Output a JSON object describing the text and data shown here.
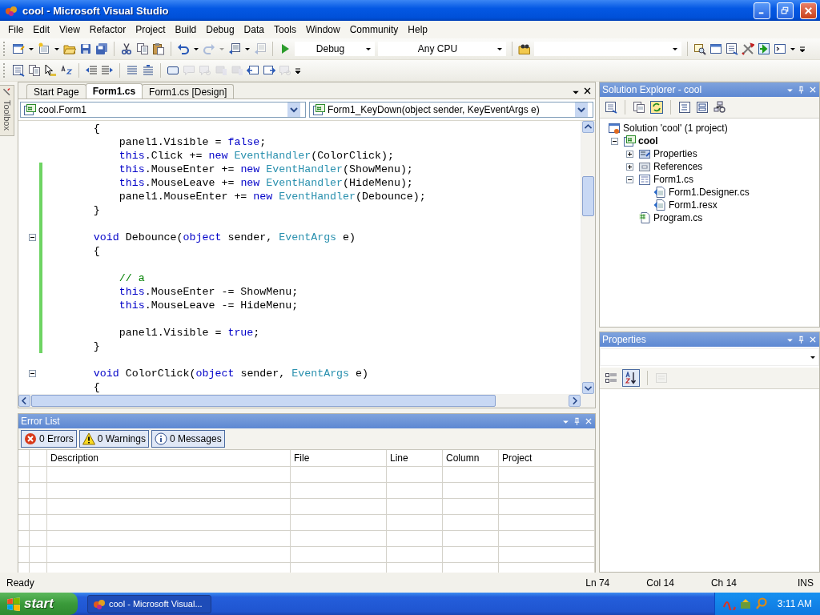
{
  "window": {
    "title": "cool - Microsoft Visual Studio"
  },
  "menu": [
    "File",
    "Edit",
    "View",
    "Refactor",
    "Project",
    "Build",
    "Debug",
    "Data",
    "Tools",
    "Window",
    "Community",
    "Help"
  ],
  "toolbar": {
    "configuration": "Debug",
    "platform": "Any CPU"
  },
  "toolbox": {
    "label": "Toolbox"
  },
  "editor": {
    "tabs": [
      {
        "label": "Start Page",
        "selected": false
      },
      {
        "label": "Form1.cs",
        "selected": true
      },
      {
        "label": "Form1.cs [Design]",
        "selected": false
      }
    ],
    "type_dropdown": "cool.Form1",
    "member_dropdown": "Form1_KeyDown(object sender, KeyEventArgs e)",
    "lines": [
      {
        "modified": false,
        "tokens": [
          {
            "kind": "plain",
            "text": "        {"
          }
        ]
      },
      {
        "modified": false,
        "tokens": [
          {
            "kind": "plain",
            "text": "            panel1.Visible = "
          },
          {
            "kind": "keyword",
            "text": "false"
          },
          {
            "kind": "plain",
            "text": ";"
          }
        ]
      },
      {
        "modified": false,
        "tokens": [
          {
            "kind": "keyword",
            "text": "            this"
          },
          {
            "kind": "plain",
            "text": ".Click += "
          },
          {
            "kind": "keyword",
            "text": "new "
          },
          {
            "kind": "type",
            "text": "EventHandler"
          },
          {
            "kind": "plain",
            "text": "(ColorClick);"
          }
        ]
      },
      {
        "modified": true,
        "tokens": [
          {
            "kind": "keyword",
            "text": "            this"
          },
          {
            "kind": "plain",
            "text": ".MouseEnter += "
          },
          {
            "kind": "keyword",
            "text": "new "
          },
          {
            "kind": "type",
            "text": "EventHandler"
          },
          {
            "kind": "plain",
            "text": "(ShowMenu);"
          }
        ]
      },
      {
        "modified": true,
        "tokens": [
          {
            "kind": "keyword",
            "text": "            this"
          },
          {
            "kind": "plain",
            "text": ".MouseLeave += "
          },
          {
            "kind": "keyword",
            "text": "new "
          },
          {
            "kind": "type",
            "text": "EventHandler"
          },
          {
            "kind": "plain",
            "text": "(HideMenu);"
          }
        ]
      },
      {
        "modified": true,
        "tokens": [
          {
            "kind": "plain",
            "text": "            panel1.MouseEnter += "
          },
          {
            "kind": "keyword",
            "text": "new "
          },
          {
            "kind": "type",
            "text": "EventHandler"
          },
          {
            "kind": "plain",
            "text": "(Debounce);"
          }
        ]
      },
      {
        "modified": true,
        "tokens": [
          {
            "kind": "plain",
            "text": "        }"
          }
        ]
      },
      {
        "modified": true
      },
      {
        "modified": true,
        "collapsible": true,
        "tokens": [
          {
            "kind": "keyword",
            "text": "        void"
          },
          {
            "kind": "plain",
            "text": " Debounce("
          },
          {
            "kind": "keyword",
            "text": "object"
          },
          {
            "kind": "plain",
            "text": " sender, "
          },
          {
            "kind": "type",
            "text": "EventArgs"
          },
          {
            "kind": "plain",
            "text": " e)"
          }
        ]
      },
      {
        "modified": true,
        "tokens": [
          {
            "kind": "plain",
            "text": "        {"
          }
        ]
      },
      {
        "modified": true
      },
      {
        "modified": true,
        "tokens": [
          {
            "kind": "comment",
            "text": "            // a"
          }
        ]
      },
      {
        "modified": true,
        "tokens": [
          {
            "kind": "keyword",
            "text": "            this"
          },
          {
            "kind": "plain",
            "text": ".MouseEnter -= ShowMenu;"
          }
        ]
      },
      {
        "modified": true,
        "tokens": [
          {
            "kind": "keyword",
            "text": "            this"
          },
          {
            "kind": "plain",
            "text": ".MouseLeave -= HideMenu;"
          }
        ]
      },
      {
        "modified": true
      },
      {
        "modified": true,
        "tokens": [
          {
            "kind": "plain",
            "text": "            panel1.Visible = "
          },
          {
            "kind": "keyword",
            "text": "true"
          },
          {
            "kind": "plain",
            "text": ";"
          }
        ]
      },
      {
        "modified": true,
        "tokens": [
          {
            "kind": "plain",
            "text": "        }"
          }
        ]
      },
      {
        "modified": false
      },
      {
        "modified": false,
        "collapsible": true,
        "tokens": [
          {
            "kind": "keyword",
            "text": "        void"
          },
          {
            "kind": "plain",
            "text": " ColorClick("
          },
          {
            "kind": "keyword",
            "text": "object"
          },
          {
            "kind": "plain",
            "text": " sender, "
          },
          {
            "kind": "type",
            "text": "EventArgs"
          },
          {
            "kind": "plain",
            "text": " e)"
          }
        ]
      },
      {
        "modified": false,
        "tokens": [
          {
            "kind": "plain",
            "text": "        {"
          }
        ]
      }
    ]
  },
  "solution_explorer": {
    "title": "Solution Explorer - cool",
    "tree": [
      {
        "label": "Solution 'cool' (1 project)",
        "kind": "solution",
        "children": [
          {
            "label": "cool",
            "kind": "project",
            "expanded": true,
            "children": [
              {
                "label": "Properties",
                "kind": "properties",
                "expanded": false
              },
              {
                "label": "References",
                "kind": "references",
                "expanded": false
              },
              {
                "label": "Form1.cs",
                "kind": "form",
                "expanded": true,
                "children": [
                  {
                    "label": "Form1.Designer.cs",
                    "kind": "dependent"
                  },
                  {
                    "label": "Form1.resx",
                    "kind": "dependent"
                  }
                ]
              },
              {
                "label": "Program.cs",
                "kind": "csharp"
              }
            ]
          }
        ]
      }
    ]
  },
  "properties": {
    "title": "Properties"
  },
  "error_list": {
    "title": "Error List",
    "filters": [
      {
        "kind": "error",
        "label": "0 Errors",
        "selected": true
      },
      {
        "kind": "warning",
        "label": "0 Warnings",
        "selected": true
      },
      {
        "kind": "info",
        "label": "0 Messages",
        "selected": true
      }
    ],
    "columns": [
      "Description",
      "File",
      "Line",
      "Column",
      "Project"
    ]
  },
  "status_bar": {
    "message": "Ready",
    "line": "Ln 74",
    "column": "Col 14",
    "char": "Ch 14",
    "mode": "INS"
  },
  "taskbar": {
    "start": "start",
    "tasks": [
      {
        "label": "cool - Microsoft Visual...",
        "selected": true
      }
    ],
    "clock": "3:11 AM"
  }
}
